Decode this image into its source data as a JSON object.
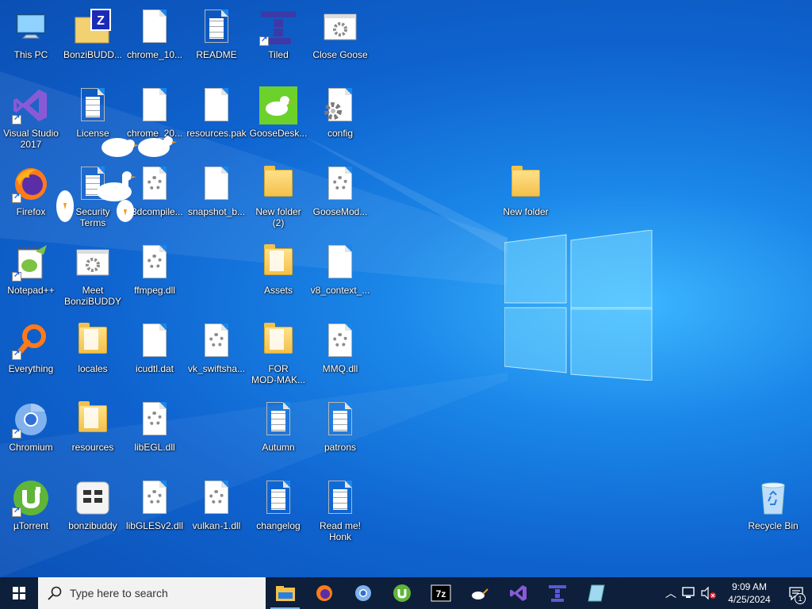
{
  "desktop": {
    "icons": [
      {
        "label": "This PC",
        "glyph": "pc",
        "col": 0,
        "row": 0,
        "shortcut": false
      },
      {
        "label": "Visual Studio\n2017",
        "glyph": "vs",
        "col": 0,
        "row": 1,
        "shortcut": true
      },
      {
        "label": "Firefox",
        "glyph": "firefox",
        "col": 0,
        "row": 2,
        "shortcut": true
      },
      {
        "label": "Notepad++",
        "glyph": "notepad",
        "col": 0,
        "row": 3,
        "shortcut": true
      },
      {
        "label": "Everything",
        "glyph": "everything",
        "col": 0,
        "row": 4,
        "shortcut": true
      },
      {
        "label": "Chromium",
        "glyph": "chromium",
        "col": 0,
        "row": 5,
        "shortcut": true
      },
      {
        "label": "µTorrent",
        "glyph": "utorrent",
        "col": 0,
        "row": 6,
        "shortcut": true
      },
      {
        "label": "BonziBUDD...",
        "glyph": "zip",
        "col": 1,
        "row": 0,
        "shortcut": false
      },
      {
        "label": "License",
        "glyph": "doclines",
        "col": 1,
        "row": 1,
        "shortcut": false
      },
      {
        "label": "Security\nTerms",
        "glyph": "doclines",
        "col": 1,
        "row": 2,
        "shortcut": false
      },
      {
        "label": "Meet\nBonziBUDDY",
        "glyph": "settings",
        "col": 1,
        "row": 3,
        "shortcut": false
      },
      {
        "label": "locales",
        "glyph": "folderpaper",
        "col": 1,
        "row": 4,
        "shortcut": false
      },
      {
        "label": "resources",
        "glyph": "folderpaper",
        "col": 1,
        "row": 5,
        "shortcut": false
      },
      {
        "label": "bonzibuddy",
        "glyph": "bonzi",
        "col": 1,
        "row": 6,
        "shortcut": false
      },
      {
        "label": "chrome_10...",
        "glyph": "doc",
        "col": 2,
        "row": 0,
        "shortcut": false
      },
      {
        "label": "chrome_20...",
        "glyph": "doc",
        "col": 2,
        "row": 1,
        "shortcut": false
      },
      {
        "label": "d3dcompile...",
        "glyph": "gear",
        "col": 2,
        "row": 2,
        "shortcut": false
      },
      {
        "label": "ffmpeg.dll",
        "glyph": "gear",
        "col": 2,
        "row": 3,
        "shortcut": false
      },
      {
        "label": "icudtl.dat",
        "glyph": "doc",
        "col": 2,
        "row": 4,
        "shortcut": false
      },
      {
        "label": "libEGL.dll",
        "glyph": "gear",
        "col": 2,
        "row": 5,
        "shortcut": false
      },
      {
        "label": "libGLESv2.dll",
        "glyph": "gear",
        "col": 2,
        "row": 6,
        "shortcut": false
      },
      {
        "label": "README",
        "glyph": "doclines",
        "col": 3,
        "row": 0,
        "shortcut": false
      },
      {
        "label": "resources.pak",
        "glyph": "doc",
        "col": 3,
        "row": 1,
        "shortcut": false
      },
      {
        "label": "snapshot_b...",
        "glyph": "doc",
        "col": 3,
        "row": 2,
        "shortcut": false
      },
      {
        "label": "vk_swiftsha...",
        "glyph": "gear",
        "col": 3,
        "row": 4,
        "shortcut": false
      },
      {
        "label": "vulkan-1.dll",
        "glyph": "gear",
        "col": 3,
        "row": 6,
        "shortcut": false
      },
      {
        "label": "Tiled",
        "glyph": "tiled",
        "col": 4,
        "row": 0,
        "shortcut": true
      },
      {
        "label": "GooseDesk...",
        "glyph": "goose",
        "col": 4,
        "row": 1,
        "shortcut": false
      },
      {
        "label": "New folder\n(2)",
        "glyph": "folder",
        "col": 4,
        "row": 2,
        "shortcut": false
      },
      {
        "label": "Assets",
        "glyph": "folderpaper",
        "col": 4,
        "row": 3,
        "shortcut": false
      },
      {
        "label": "FOR\nMOD-MAK...",
        "glyph": "folderpaper",
        "col": 4,
        "row": 4,
        "shortcut": false
      },
      {
        "label": "Autumn",
        "glyph": "doclines",
        "col": 4,
        "row": 5,
        "shortcut": false
      },
      {
        "label": "changelog",
        "glyph": "doclines",
        "col": 4,
        "row": 6,
        "shortcut": false
      },
      {
        "label": "Close Goose",
        "glyph": "settings",
        "col": 5,
        "row": 0,
        "shortcut": false
      },
      {
        "label": "config",
        "glyph": "config",
        "col": 5,
        "row": 1,
        "shortcut": false
      },
      {
        "label": "GooseMod...",
        "glyph": "gear",
        "col": 5,
        "row": 2,
        "shortcut": false
      },
      {
        "label": "v8_context_...",
        "glyph": "doc",
        "col": 5,
        "row": 3,
        "shortcut": false
      },
      {
        "label": "MMQ.dll",
        "glyph": "gear",
        "col": 5,
        "row": 4,
        "shortcut": false
      },
      {
        "label": "patrons",
        "glyph": "doclines",
        "col": 5,
        "row": 5,
        "shortcut": false
      },
      {
        "label": "Read me!\nHonk",
        "glyph": "doclines",
        "col": 5,
        "row": 6,
        "shortcut": false
      }
    ],
    "free_icons": [
      {
        "id": "new-folder",
        "label": "New folder",
        "glyph": "folder"
      },
      {
        "id": "recycle-bin",
        "label": "Recycle Bin",
        "glyph": "recycle"
      }
    ]
  },
  "taskbar": {
    "search_placeholder": "Type here to search",
    "apps": [
      {
        "name": "file-explorer",
        "running": true
      },
      {
        "name": "firefox",
        "running": false
      },
      {
        "name": "chromium",
        "running": false
      },
      {
        "name": "utorrent",
        "running": false
      },
      {
        "name": "7zip",
        "running": false
      },
      {
        "name": "goose",
        "running": false
      },
      {
        "name": "visual-studio",
        "running": false
      },
      {
        "name": "tiled",
        "running": false
      },
      {
        "name": "notepad",
        "running": false
      }
    ],
    "clock_time": "9:09 AM",
    "clock_date": "4/25/2024",
    "notification_count": "1"
  },
  "colors": {
    "taskbar": "#0d1f3a",
    "desktop_accent": "#1a86e8",
    "search_bg": "#f2f2f2"
  }
}
